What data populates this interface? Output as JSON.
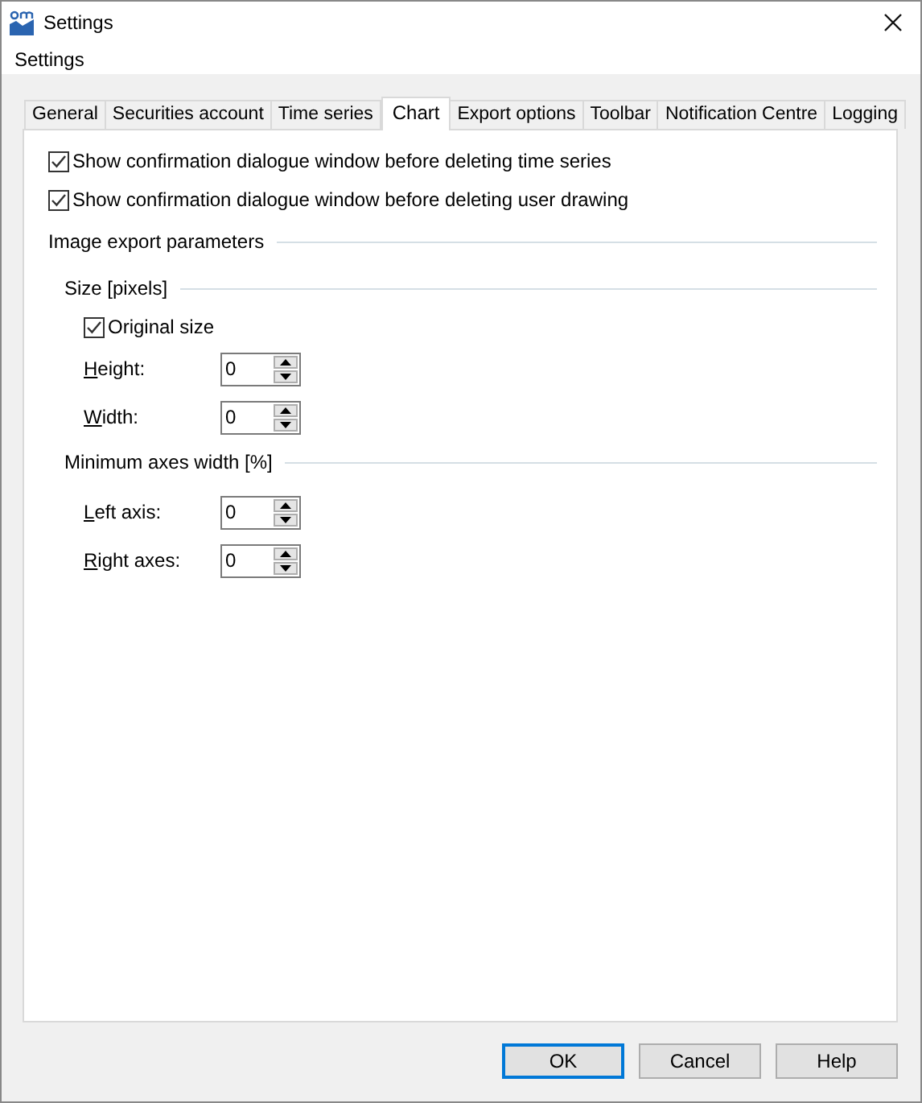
{
  "window": {
    "title": "Settings",
    "heading": "Settings"
  },
  "tabs": [
    {
      "label": "General",
      "selected": false
    },
    {
      "label": "Securities account",
      "selected": false
    },
    {
      "label": "Time series",
      "selected": false
    },
    {
      "label": "Chart",
      "selected": true
    },
    {
      "label": "Export options",
      "selected": false
    },
    {
      "label": "Toolbar",
      "selected": false
    },
    {
      "label": "Notification Centre",
      "selected": false
    },
    {
      "label": "Logging",
      "selected": false
    }
  ],
  "options": [
    {
      "label": "Show confirmation dialogue window before deleting time series",
      "checked": true
    },
    {
      "label": "Show confirmation dialogue window before deleting user drawing",
      "checked": true
    }
  ],
  "image_export": {
    "title": "Image export parameters",
    "size": {
      "title": "Size [pixels]",
      "original_size": {
        "label": "Original size",
        "checked": true
      },
      "fields": [
        {
          "access_key": "H",
          "label_rest": "eight:",
          "value": "0"
        },
        {
          "access_key": "W",
          "label_rest": "idth:",
          "value": "0"
        }
      ]
    },
    "axes": {
      "title": "Minimum axes width [%]",
      "fields": [
        {
          "access_key": "L",
          "label_rest": "eft axis:",
          "value": "0"
        },
        {
          "access_key": "R",
          "label_rest": "ight axes:",
          "value": "0"
        }
      ]
    }
  },
  "buttons": [
    {
      "label": "OK",
      "default": true
    },
    {
      "label": "Cancel",
      "default": false
    },
    {
      "label": "Help",
      "default": false
    }
  ]
}
